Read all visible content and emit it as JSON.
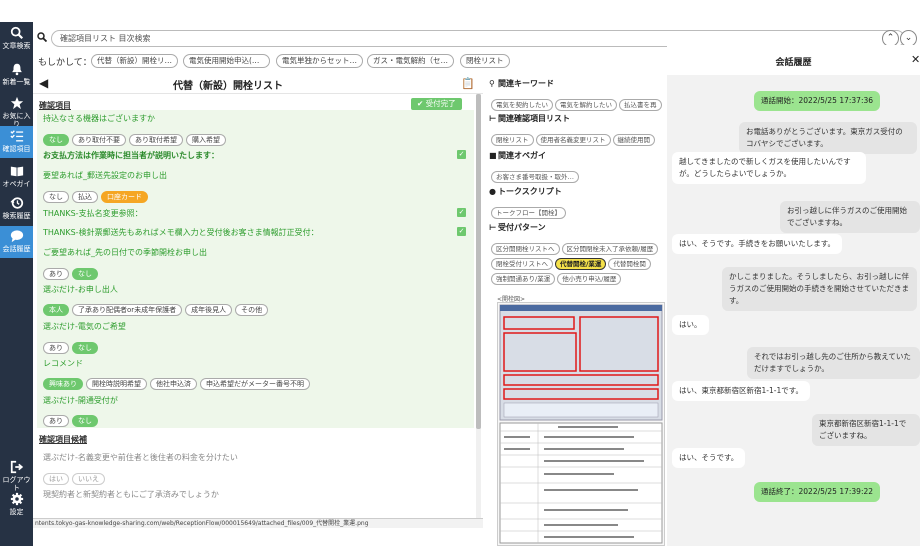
{
  "sidebar": {
    "items": [
      {
        "label": "文章検索",
        "icon": "search-icon"
      },
      {
        "label": "新着一覧",
        "icon": "bell-icon"
      },
      {
        "label": "お気に入り",
        "icon": "star-icon"
      },
      {
        "label": "確認項目",
        "icon": "checklist-icon"
      },
      {
        "label": "オペガイ",
        "icon": "book-icon"
      },
      {
        "label": "検索履歴",
        "icon": "history-icon"
      },
      {
        "label": "会話履歴",
        "icon": "chat-icon"
      },
      {
        "label": "ログアウト",
        "icon": "logout-icon"
      },
      {
        "label": "設定",
        "icon": "gear-icon"
      }
    ]
  },
  "search": {
    "value": "確認項目リスト 目次検索"
  },
  "suggest": {
    "label": "もしかして：",
    "items": [
      "代替（新設）開栓リ…",
      "電気使用開始申込(…",
      "電気単独からセット…",
      "ガス・電気解約（セ…",
      "閉栓リスト"
    ]
  },
  "main": {
    "title": "代替（新設）開栓リスト",
    "section1": {
      "title": "確認項目",
      "badge": "受付完了",
      "questions": [
        {
          "text": "持込なさる機器はございますか",
          "options": [
            "なし",
            "あり取付不要",
            "あり取付希望",
            "購入希望"
          ]
        },
        {
          "text": "お支払方法は作業時に担当者が説明いたします：",
          "options": []
        },
        {
          "text": "要望あれば_郵送先設定のお申し出",
          "options": [
            "なし",
            "払込",
            "口座カード"
          ]
        },
        {
          "text": "THANKS-支払名変更参照：",
          "options": []
        },
        {
          "text": "THANKS-検針票郵送先もあればメモ欄入力と受付後お客さま情報訂正受付：",
          "options": []
        },
        {
          "text": "ご要望あれば_先の日付での季節開栓お申し出",
          "options": [
            "あり",
            "なし"
          ]
        },
        {
          "text": "選ぶだけ-お申し出人",
          "options": [
            "本人",
            "了承あり配偶者or未成年保護者",
            "成年後見人",
            "その他"
          ]
        },
        {
          "text": "選ぶだけ-電気のご希望",
          "options": [
            "あり",
            "なし"
          ]
        },
        {
          "text": "レコメンド",
          "options": [
            "興味あり",
            "開栓時説明希望",
            "他社申込済",
            "申込希望だがメーター番号不明"
          ]
        },
        {
          "text": "選ぶだけ-開通受付が",
          "options": [
            "あり",
            "なし"
          ]
        }
      ]
    },
    "section2": {
      "title": "確認項目候補",
      "questions": [
        {
          "text": "選ぶだけ-名義変更や前住者と後住者の料金を分けたい",
          "options": [
            "はい",
            "いいえ"
          ]
        },
        {
          "text": "現契約者と新契約者ともにご了承済みでしょうか",
          "options": []
        }
      ]
    }
  },
  "status_url": "ntents.tokyo-gas-knowledge-sharing.com/web/ReceptionFlow/000015649/attached_files/009_代替開栓_業運.png",
  "info": {
    "keywords": {
      "title": "関連キーワード",
      "items": [
        "電気を契約したい",
        "電気を解約したい",
        "払込書を再"
      ]
    },
    "related": {
      "title": "関連確認項目リスト",
      "items": [
        "閉栓リスト",
        "使用者名義変更リスト",
        "継続使用開"
      ]
    },
    "opeguide": {
      "title": "関連オペガイ",
      "items": [
        "お客さま番号取扱・取外…"
      ]
    },
    "script": {
      "title": "トークスクリプト",
      "items": [
        "トークフロー【開栓】"
      ]
    },
    "patterns": {
      "title": "受付パターン",
      "items": [
        "区分開閉栓リストへ",
        "区分開閉栓未入了承依頼/履歴",
        "閉栓受付リストへ",
        "代替開栓/業運",
        "代替開栓関",
        "強制開通あり/業運",
        "他小売り申込/履歴"
      ]
    },
    "caption": "<開栓図>"
  },
  "chat": {
    "title": "会話履歴",
    "messages": [
      {
        "text": "通話開始：2022/5/25 17:37:36",
        "type": "sys"
      },
      {
        "text": "お電話ありがとうございます。東京ガス受付のコバヤシでございます。",
        "type": "right"
      },
      {
        "text": "越してきましたので新しくガスを使用したいんですが。どうしたらよいでしょうか。",
        "type": "left"
      },
      {
        "text": "お引っ越しに伴うガスのご使用開始でございますね。",
        "type": "right"
      },
      {
        "text": "はい、そうです。手続きをお願いいたします。",
        "type": "left"
      },
      {
        "text": "かしこまりました。そうしましたら、お引っ越しに伴うガスのご使用開始の手続きを開始させていただきます。",
        "type": "right"
      },
      {
        "text": "はい。",
        "type": "left"
      },
      {
        "text": "それではお引っ越し先のご住所から教えていただけますでしょうか。",
        "type": "right"
      },
      {
        "text": "はい、東京都新宿区新宿1-1-1です。",
        "type": "left"
      },
      {
        "text": "東京都新宿区新宿1-1-1でございますね。",
        "type": "right"
      },
      {
        "text": "はい、そうです。",
        "type": "left"
      },
      {
        "text": "通話終了：2022/5/25 17:39:22",
        "type": "sys"
      }
    ]
  },
  "colors": {
    "sidebar": "#263244",
    "accent": "#3b8fd6",
    "green": "#6ec86e",
    "orange": "#f5a623"
  }
}
